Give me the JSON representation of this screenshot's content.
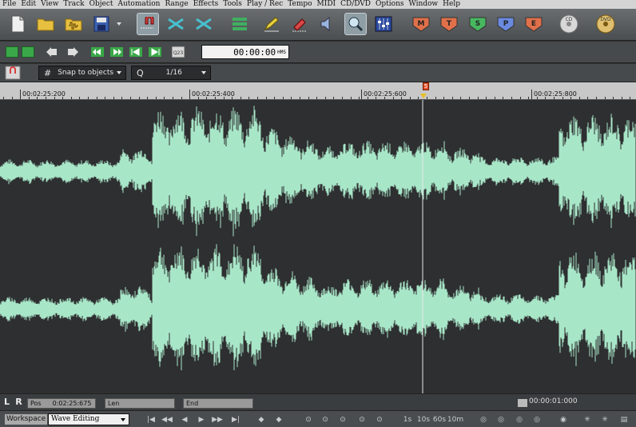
{
  "menu": [
    "File",
    "Edit",
    "View",
    "Track",
    "Object",
    "Automation",
    "Range",
    "Effects",
    "Tools",
    "Play / Rec",
    "Tempo",
    "MIDI",
    "CD/DVD",
    "Options",
    "Window",
    "Help"
  ],
  "toolbar": {
    "mode_buttons": [
      "M",
      "T",
      "S",
      "P",
      "E"
    ],
    "mode_colors": [
      "#e0704a",
      "#e0704a",
      "#48b860",
      "#6a8ae0",
      "#e0704a"
    ],
    "cd_label": "CD",
    "dvd_label": "DVD"
  },
  "transport_bar": {
    "timecode": "00:00:00",
    "timecode_unit": "HMS",
    "cue_label": "Q23"
  },
  "snap": {
    "label": "Snap to objects",
    "quantize_symbol": "Q",
    "quantize_value": "1/16"
  },
  "ruler": {
    "labels": [
      "00:02:25:200",
      "00:02:25:400",
      "00:02:25:600",
      "00:02:25:800"
    ],
    "marker_label": "5"
  },
  "waveform": {
    "color": "#a8e6c8",
    "background": "#2e2f31"
  },
  "status": {
    "L": "L",
    "R": "R",
    "pos_label": "Pos",
    "pos_value": "0:02:25:675",
    "len_label": "Len",
    "end_label": "End",
    "zoom_time": "00:00:01:000"
  },
  "bottom": {
    "workspace_label": "Workspace",
    "workspace_value": "Wave Editing",
    "time_steps": [
      "1s",
      "10s",
      "60s",
      "10m"
    ]
  }
}
